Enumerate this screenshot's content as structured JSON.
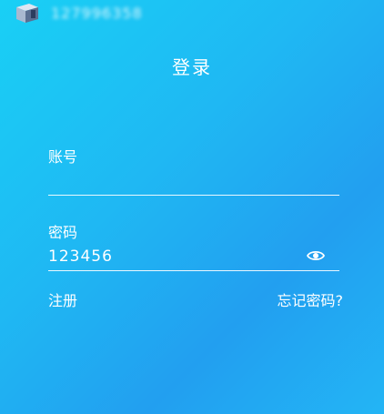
{
  "status_bar": {
    "account_masked": "127996358"
  },
  "login": {
    "title": "登录",
    "username": {
      "label": "账号",
      "value": "",
      "placeholder": ""
    },
    "password": {
      "label": "密码",
      "value": "123456",
      "visibility_icon": "eye-icon"
    },
    "register_link": "注册",
    "forgot_link": "忘记密码?"
  },
  "colors": {
    "gradient_start": "#19d0f5",
    "gradient_end": "#229ff0",
    "text": "#ffffff"
  }
}
